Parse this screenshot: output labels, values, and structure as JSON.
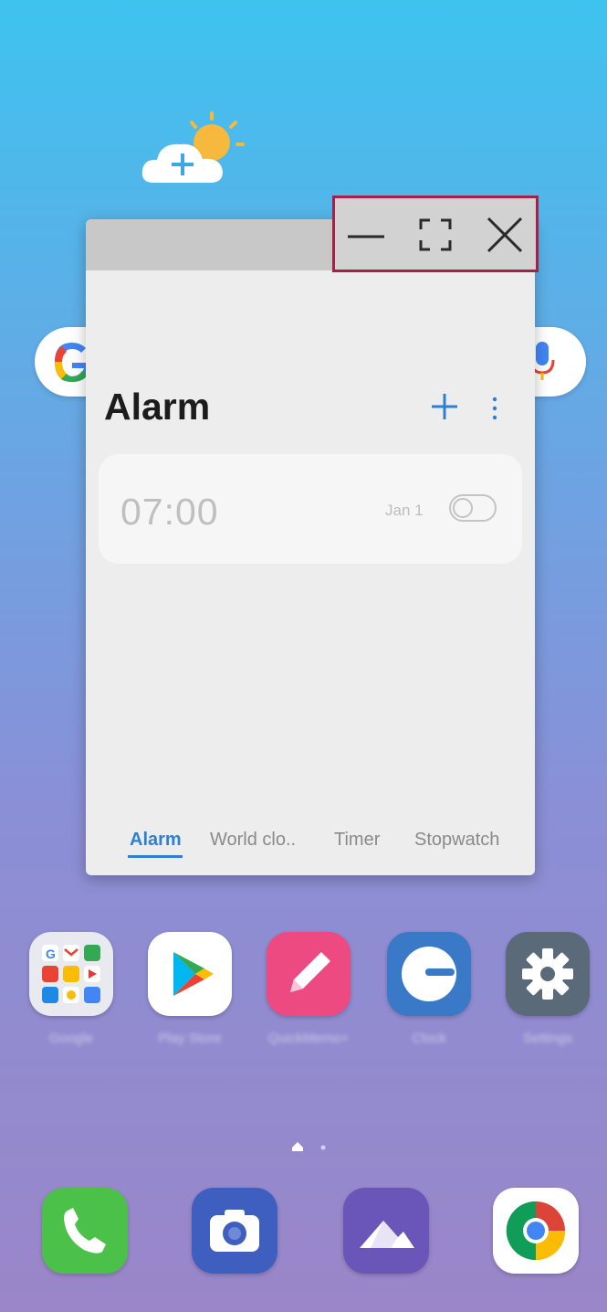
{
  "popup": {
    "title": "Alarm",
    "alarm_time": "07:00",
    "alarm_date": "Jan 1",
    "tabs": [
      "Alarm",
      "World clo..",
      "Timer",
      "Stopwatch"
    ],
    "active_tab": "Alarm"
  },
  "window_controls": [
    "minimize",
    "maximize",
    "close"
  ],
  "apps": [
    {
      "label": "Google",
      "icon": "google-folder-icon"
    },
    {
      "label": "Play Store",
      "icon": "play-store-icon"
    },
    {
      "label": "QuickMemo+",
      "icon": "quickmemo-icon"
    },
    {
      "label": "Clock",
      "icon": "clock-icon"
    },
    {
      "label": "Settings",
      "icon": "gear-icon"
    }
  ],
  "dock": [
    {
      "icon": "phone-icon"
    },
    {
      "icon": "camera-icon"
    },
    {
      "icon": "gallery-icon"
    },
    {
      "icon": "chrome-icon"
    }
  ],
  "colors": {
    "accent": "#2f7fcf",
    "highlight_border": "#a4214a"
  }
}
